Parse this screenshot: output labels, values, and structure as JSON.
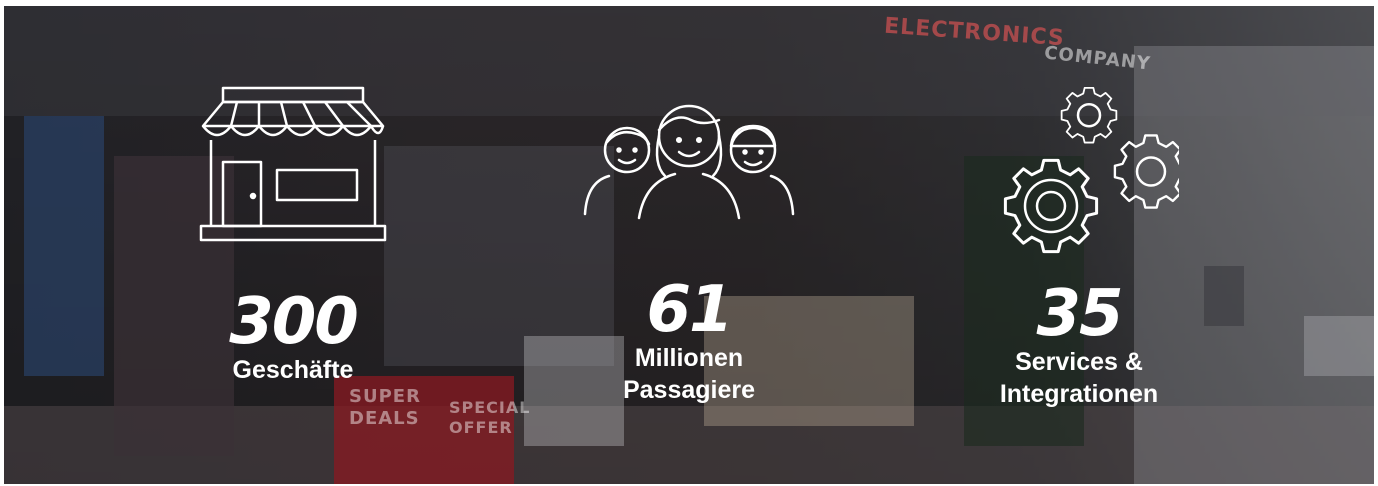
{
  "banner": {
    "store_sign_left": "ELECTRONICS",
    "store_sign_right": "COMPANY",
    "promo_left": "SUPER DEALS",
    "promo_right": "SPECIAL OFFER"
  },
  "stats": [
    {
      "icon": "storefront-icon",
      "value": "300",
      "label_line1": "Geschäfte",
      "label_line2": ""
    },
    {
      "icon": "people-group-icon",
      "value": "61",
      "label_line1": "Millionen",
      "label_line2": "Passagiere"
    },
    {
      "icon": "gears-icon",
      "value": "35",
      "label_line1": "Services &",
      "label_line2": "Integrationen"
    }
  ]
}
